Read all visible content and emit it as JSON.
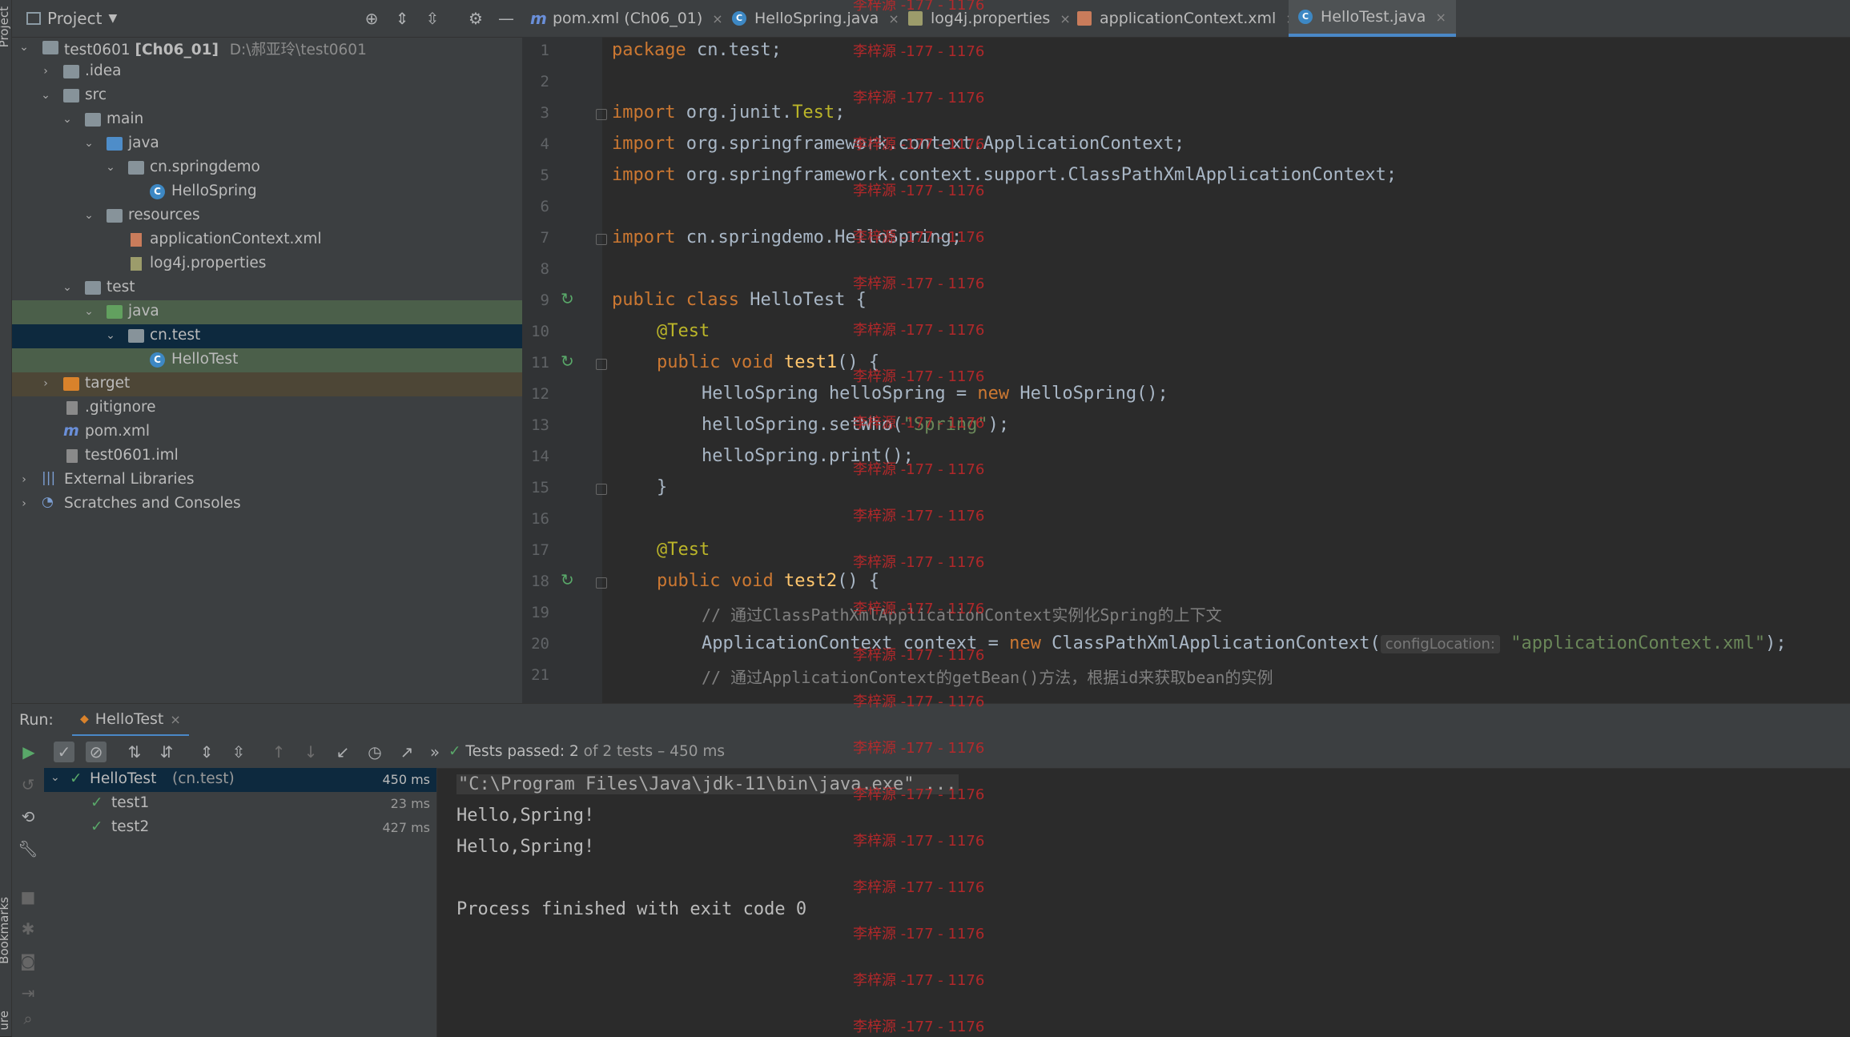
{
  "project": {
    "title": "Project",
    "tree": [
      {
        "label": "test0601",
        "bold": "[Ch06_01]",
        "path": "D:\\郝亚玲\\test0601"
      },
      {
        "label": ".idea"
      },
      {
        "label": "src"
      },
      {
        "label": "main"
      },
      {
        "label": "java"
      },
      {
        "label": "cn.springdemo"
      },
      {
        "label": "HelloSpring"
      },
      {
        "label": "resources"
      },
      {
        "label": "applicationContext.xml"
      },
      {
        "label": "log4j.properties"
      },
      {
        "label": "test"
      },
      {
        "label": "java"
      },
      {
        "label": "cn.test"
      },
      {
        "label": "HelloTest"
      },
      {
        "label": "target"
      },
      {
        "label": ".gitignore"
      },
      {
        "label": "pom.xml"
      },
      {
        "label": "test0601.iml"
      },
      {
        "label": "External Libraries"
      },
      {
        "label": "Scratches and Consoles"
      }
    ]
  },
  "side_labels": {
    "project": "Project",
    "bookmarks": "Bookmarks",
    "structure": "ure"
  },
  "tabs": [
    {
      "label": "pom.xml (Ch06_01)",
      "icon": "m"
    },
    {
      "label": "HelloSpring.java",
      "icon": "C"
    },
    {
      "label": "log4j.properties",
      "icon": "p"
    },
    {
      "label": "applicationContext.xml",
      "icon": "x"
    },
    {
      "label": "HelloTest.java",
      "icon": "C"
    }
  ],
  "tab_close": "×",
  "editor": {
    "line_numbers": [
      "1",
      "2",
      "3",
      "4",
      "5",
      "6",
      "7",
      "8",
      "9",
      "10",
      "11",
      "12",
      "13",
      "14",
      "15",
      "16",
      "17",
      "18",
      "19",
      "20",
      "21"
    ],
    "code": {
      "l1_kw": "package",
      "l1_rest": " cn.test;",
      "l3_kw": "import",
      "l3_rest": " org.junit.",
      "l3_an": "Test",
      "l3_end": ";",
      "l4_kw": "import",
      "l4_rest": " org.springframework.context.ApplicationContext;",
      "l5_kw": "import",
      "l5_rest": " org.springframework.context.support.ClassPathXmlApplicationContext;",
      "l7_kw": "import",
      "l7_rest": " cn.springdemo.HelloSpring;",
      "l9_kw": "public class",
      "l9_rest": " HelloTest {",
      "l10_an": "@Test",
      "l11_kw": "public void",
      "l11_fn": "test1",
      "l11_rest": "() {",
      "l12_a": "HelloSpring helloSpring = ",
      "l12_kw": "new",
      "l12_b": " HelloSpring();",
      "l13_a": "helloSpring.setWho(",
      "l13_str": "\"Spring\"",
      "l13_b": ");",
      "l14": "helloSpring.print();",
      "l15": "}",
      "l17_an": "@Test",
      "l18_kw": "public void",
      "l18_fn": "test2",
      "l18_rest": "() {",
      "l19_cm": "// 通过ClassPathXmlApplicationContext实例化Spring的上下文",
      "l20_a": "ApplicationContext context = ",
      "l20_kw": "new",
      "l20_b": " ClassPathXmlApplicationContext(",
      "l20_hint": "configLocation:",
      "l20_str": "\"applicationContext.xml\"",
      "l20_c": ");",
      "l21_cm": "// 通过ApplicationContext的getBean()方法，根据id来获取bean的实例"
    }
  },
  "run": {
    "label": "Run:",
    "tab": "HelloTest",
    "status_prefix": "Tests passed:",
    "status_count": "2",
    "status_rest": "of 2 tests – 450 ms",
    "tests": [
      {
        "name": "HelloTest",
        "sub": "(cn.test)",
        "time": "450 ms"
      },
      {
        "name": "test1",
        "time": "23 ms"
      },
      {
        "name": "test2",
        "time": "427 ms"
      }
    ],
    "console": [
      "\"C:\\Program Files\\Java\\jdk-11\\bin\\java.exe\" ...",
      "Hello,Spring!",
      "Hello,Spring!",
      "",
      "Process finished with exit code 0"
    ]
  },
  "watermark": "李梓源 -177 - 1176",
  "colors": {
    "accent": "#4a88c7",
    "pass": "#59a869",
    "keyword": "#cc7832",
    "string": "#6a8759"
  }
}
